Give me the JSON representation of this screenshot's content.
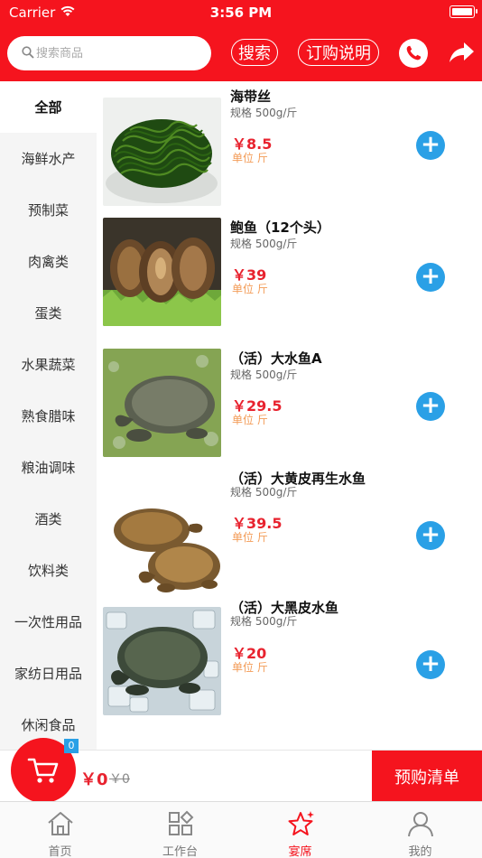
{
  "status_bar": {
    "carrier": "Carrier",
    "time": "3:56 PM"
  },
  "header": {
    "search_placeholder": "搜索商品",
    "search_button": "搜索",
    "guide_button": "订购说明",
    "phone_icon": "phone-icon",
    "share_icon": "share-icon"
  },
  "categories": [
    "全部",
    "海鲜水产",
    "预制菜",
    "肉禽类",
    "蛋类",
    "水果蔬菜",
    "熟食腊味",
    "粮油调味",
    "酒类",
    "饮料类",
    "一次性用品",
    "家纺日用品",
    "休闲食品"
  ],
  "active_category": "全部",
  "products": [
    {
      "name": "海带丝",
      "spec": "规格 500g/斤",
      "price": "￥8.5",
      "unit": "单位 斤"
    },
    {
      "name": "鲍鱼（12个头）",
      "spec": "规格 500g/斤",
      "price": "￥39",
      "unit": "单位 斤"
    },
    {
      "name": "（活）大水鱼A",
      "spec": "规格 500g/斤",
      "price": "￥29.5",
      "unit": "单位 斤"
    },
    {
      "name": "（活）大黄皮再生水鱼",
      "spec": "规格 500g/斤",
      "price": "￥39.5",
      "unit": "单位 斤"
    },
    {
      "name": "（活）大黑皮水鱼",
      "spec": "规格 500g/斤",
      "price": "￥20",
      "unit": "单位 斤"
    }
  ],
  "cart": {
    "count": "0",
    "total": "￥0",
    "original": "￥0",
    "checkout_label": "预购清单"
  },
  "tabs": [
    {
      "label": "首页",
      "icon": "home-icon"
    },
    {
      "label": "工作台",
      "icon": "workbench-icon"
    },
    {
      "label": "宴席",
      "icon": "star-icon"
    },
    {
      "label": "我的",
      "icon": "user-icon"
    }
  ],
  "active_tab": "宴席",
  "colors": {
    "brand_red": "#f5141e",
    "price_red": "#e8232f",
    "accent_blue": "#2aa0e6",
    "unit_orange": "#f39b56"
  }
}
